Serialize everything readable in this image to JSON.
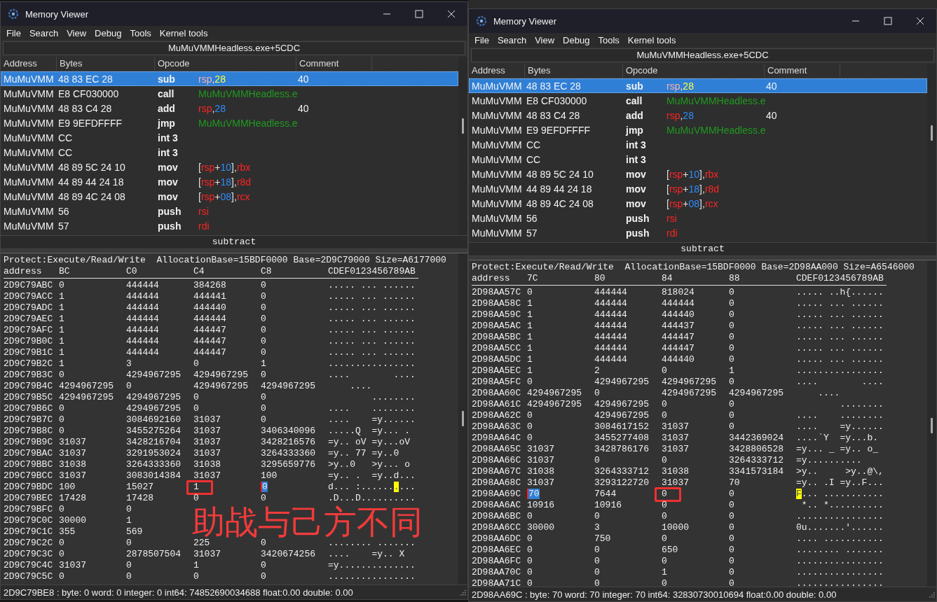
{
  "windows": [
    {
      "title": "Memory Viewer",
      "menu": [
        "File",
        "Search",
        "View",
        "Debug",
        "Tools",
        "Kernel tools"
      ],
      "address": "MuMuVMMHeadless.exe+5CDC",
      "disasm": {
        "columns": [
          "Address",
          "Bytes",
          "Opcode",
          "Comment"
        ],
        "rows": [
          {
            "address": "MuMuVMM",
            "bytes": "48 83 EC 28",
            "mnemonic": "sub",
            "operands": [
              {
                "text": "rsp",
                "kind": "reg"
              },
              {
                "text": ",",
                "kind": "punct"
              },
              {
                "text": "28",
                "kind": "num"
              }
            ],
            "comment": "40",
            "selected": true
          },
          {
            "address": "MuMuVMM",
            "bytes": "E8 CF030000",
            "mnemonic": "call",
            "operands": [
              {
                "text": "MuMuVMMHeadless.e",
                "kind": "sym"
              }
            ],
            "comment": "",
            "selected": false
          },
          {
            "address": "MuMuVMM",
            "bytes": "48 83 C4 28",
            "mnemonic": "add",
            "operands": [
              {
                "text": "rsp",
                "kind": "reg"
              },
              {
                "text": ",",
                "kind": "punct"
              },
              {
                "text": "28",
                "kind": "num"
              }
            ],
            "comment": "40",
            "selected": false
          },
          {
            "address": "MuMuVMM",
            "bytes": "E9 9EFDFFFF",
            "mnemonic": "jmp",
            "operands": [
              {
                "text": "MuMuVMMHeadless.e",
                "kind": "sym"
              }
            ],
            "comment": "",
            "selected": false
          },
          {
            "address": "MuMuVMM",
            "bytes": "CC",
            "mnemonic": "int 3",
            "operands": [],
            "comment": "",
            "selected": false
          },
          {
            "address": "MuMuVMM",
            "bytes": "CC",
            "mnemonic": "int 3",
            "operands": [],
            "comment": "",
            "selected": false
          },
          {
            "address": "MuMuVMM",
            "bytes": "48 89 5C 24 10",
            "mnemonic": "mov",
            "operands": [
              {
                "text": "[",
                "kind": "punct"
              },
              {
                "text": "rsp",
                "kind": "reg"
              },
              {
                "text": "+",
                "kind": "punct"
              },
              {
                "text": "10",
                "kind": "num"
              },
              {
                "text": "],",
                "kind": "punct"
              },
              {
                "text": "rbx",
                "kind": "reg"
              }
            ],
            "comment": "",
            "selected": false
          },
          {
            "address": "MuMuVMM",
            "bytes": "44 89 44 24 18",
            "mnemonic": "mov",
            "operands": [
              {
                "text": "[",
                "kind": "punct"
              },
              {
                "text": "rsp",
                "kind": "reg"
              },
              {
                "text": "+",
                "kind": "punct"
              },
              {
                "text": "18",
                "kind": "num"
              },
              {
                "text": "],",
                "kind": "punct"
              },
              {
                "text": "r8d",
                "kind": "reg"
              }
            ],
            "comment": "",
            "selected": false
          },
          {
            "address": "MuMuVMM",
            "bytes": "48 89 4C 24 08",
            "mnemonic": "mov",
            "operands": [
              {
                "text": "[",
                "kind": "punct"
              },
              {
                "text": "rsp",
                "kind": "reg"
              },
              {
                "text": "+",
                "kind": "punct"
              },
              {
                "text": "08",
                "kind": "num"
              },
              {
                "text": "],",
                "kind": "punct"
              },
              {
                "text": "rcx",
                "kind": "reg"
              }
            ],
            "comment": "",
            "selected": false
          },
          {
            "address": "MuMuVMM",
            "bytes": "56",
            "mnemonic": "push",
            "operands": [
              {
                "text": "rsi",
                "kind": "reg"
              }
            ],
            "comment": "",
            "selected": false
          },
          {
            "address": "MuMuVMM",
            "bytes": "57",
            "mnemonic": "push",
            "operands": [
              {
                "text": "rdi",
                "kind": "reg"
              }
            ],
            "comment": "",
            "selected": false
          }
        ]
      },
      "description": "subtract",
      "hex": {
        "info": "Protect:Execute/Read/Write  AllocationBase=15BDF0000 Base=2D9C79000 Size=A6177000",
        "address_header": "address",
        "columns": [
          "BC",
          "C0",
          "C4",
          "C8"
        ],
        "ascii_header": "CDEF0123456789AB",
        "rows": [
          {
            "address": "2D9C79ABC",
            "cells": [
              "0",
              "444444",
              "384268",
              "0"
            ],
            "ascii": "..... ... ......"
          },
          {
            "address": "2D9C79ACC",
            "cells": [
              "1",
              "444444",
              "444441",
              "0"
            ],
            "ascii": "..... ... ......"
          },
          {
            "address": "2D9C79ADC",
            "cells": [
              "1",
              "444444",
              "444440",
              "0"
            ],
            "ascii": "..... ... ......"
          },
          {
            "address": "2D9C79AEC",
            "cells": [
              "1",
              "444444",
              "444444",
              "0"
            ],
            "ascii": "..... ... ......"
          },
          {
            "address": "2D9C79AFC",
            "cells": [
              "1",
              "444444",
              "444447",
              "0"
            ],
            "ascii": "..... ... ......"
          },
          {
            "address": "2D9C79B0C",
            "cells": [
              "1",
              "444444",
              "444447",
              "0"
            ],
            "ascii": "..... ... ......"
          },
          {
            "address": "2D9C79B1C",
            "cells": [
              "1",
              "444444",
              "444447",
              "0"
            ],
            "ascii": "..... ... ......"
          },
          {
            "address": "2D9C79B2C",
            "cells": [
              "1",
              "3",
              "0",
              "1"
            ],
            "ascii": "................"
          },
          {
            "address": "2D9C79B3C",
            "cells": [
              "0",
              "4294967295",
              "4294967295",
              "0"
            ],
            "ascii": "....        ...."
          },
          {
            "address": "2D9C79B4C",
            "cells": [
              "4294967295",
              "0",
              "4294967295",
              "4294967295"
            ],
            "ascii": "    ...."
          },
          {
            "address": "2D9C79B5C",
            "cells": [
              "4294967295",
              "4294967295",
              "0",
              "0"
            ],
            "ascii": "        ........"
          },
          {
            "address": "2D9C79B6C",
            "cells": [
              "0",
              "4294967295",
              "0",
              "0"
            ],
            "ascii": "....    ........"
          },
          {
            "address": "2D9C79B7C",
            "cells": [
              "0",
              "3084692160",
              "31037",
              "0"
            ],
            "ascii": "....    =y......"
          },
          {
            "address": "2D9C79B8C",
            "cells": [
              "0",
              "3455275264",
              "31037",
              "3406340096"
            ],
            "ascii": ".....Q  =y... ."
          },
          {
            "address": "2D9C79B9C",
            "cells": [
              "31037",
              "3428216704",
              "31037",
              "3428216576"
            ],
            "ascii": "=y.. oV =y...oV"
          },
          {
            "address": "2D9C79BAC",
            "cells": [
              "31037",
              "3291953024",
              "31037",
              "3264333360"
            ],
            "ascii": "=y.. 77 =y..0"
          },
          {
            "address": "2D9C79BBC",
            "cells": [
              "31038",
              "3264333360",
              "31038",
              "3295659776"
            ],
            "ascii": ">y..0   >y... o"
          },
          {
            "address": "2D9C79BCC",
            "cells": [
              "31037",
              "3083014384",
              "31037",
              "100"
            ],
            "ascii": "=y.. .  =y..d..."
          },
          {
            "address": "2D9C79BDC",
            "cells": [
              "100",
              "15027",
              {
                "text": "1",
                "framed": true,
                "cursor": false
              },
              {
                "text": "0",
                "framed": false,
                "cursor": true
              }
            ],
            "ascii": [
              {
                "text": "d... :......",
                "cursor": false
              },
              {
                "text": ".",
                "cursor": true
              },
              {
                "text": "...",
                "cursor": false
              }
            ]
          },
          {
            "address": "2D9C79BEC",
            "cells": [
              "17428",
              "17428",
              "0",
              "0"
            ],
            "ascii": ".D...D.........."
          },
          {
            "address": "2D9C79BFC",
            "cells": [
              "0",
              "0",
              null,
              null
            ]
          },
          {
            "address": "2D9C79C0C",
            "cells": [
              "30000",
              "1",
              null,
              null
            ]
          },
          {
            "address": "2D9C79C1C",
            "cells": [
              "355",
              "569",
              null,
              null
            ]
          },
          {
            "address": "2D9C79C2C",
            "cells": [
              "0",
              "0",
              "225",
              "0"
            ],
            "ascii": "........ ......."
          },
          {
            "address": "2D9C79C3C",
            "cells": [
              "0",
              "2878507504",
              "31037",
              "3420674256"
            ],
            "ascii": "....    =y.. X"
          },
          {
            "address": "2D9C79C4C",
            "cells": [
              "31037",
              "0",
              "1",
              "0"
            ],
            "ascii": "=y.............."
          },
          {
            "address": "2D9C79C5C",
            "cells": [
              "0",
              "0",
              "0",
              "0"
            ],
            "ascii": "................"
          }
        ]
      },
      "status": "2D9C79BE8 : byte: 0 word: 0 integer: 0 int64: 74852690034688 float:0.00 double: 0.00"
    },
    {
      "title": "Memory Viewer",
      "menu": [
        "File",
        "Search",
        "View",
        "Debug",
        "Tools",
        "Kernel tools"
      ],
      "address": "MuMuVMMHeadless.exe+5CDC",
      "disasm": {
        "columns": [
          "Address",
          "Bytes",
          "Opcode",
          "Comment"
        ],
        "rows": [
          {
            "address": "MuMuVMM",
            "bytes": "48 83 EC 28",
            "mnemonic": "sub",
            "operands": [
              {
                "text": "rsp",
                "kind": "reg"
              },
              {
                "text": ",",
                "kind": "punct"
              },
              {
                "text": "28",
                "kind": "num"
              }
            ],
            "comment": "40",
            "selected": true
          },
          {
            "address": "MuMuVMM",
            "bytes": "E8 CF030000",
            "mnemonic": "call",
            "operands": [
              {
                "text": "MuMuVMMHeadless.e",
                "kind": "sym"
              }
            ],
            "comment": "",
            "selected": false
          },
          {
            "address": "MuMuVMM",
            "bytes": "48 83 C4 28",
            "mnemonic": "add",
            "operands": [
              {
                "text": "rsp",
                "kind": "reg"
              },
              {
                "text": ",",
                "kind": "punct"
              },
              {
                "text": "28",
                "kind": "num"
              }
            ],
            "comment": "40",
            "selected": false
          },
          {
            "address": "MuMuVMM",
            "bytes": "E9 9EFDFFFF",
            "mnemonic": "jmp",
            "operands": [
              {
                "text": "MuMuVMMHeadless.e",
                "kind": "sym"
              }
            ],
            "comment": "",
            "selected": false
          },
          {
            "address": "MuMuVMM",
            "bytes": "CC",
            "mnemonic": "int 3",
            "operands": [],
            "comment": "",
            "selected": false
          },
          {
            "address": "MuMuVMM",
            "bytes": "CC",
            "mnemonic": "int 3",
            "operands": [],
            "comment": "",
            "selected": false
          },
          {
            "address": "MuMuVMM",
            "bytes": "48 89 5C 24 10",
            "mnemonic": "mov",
            "operands": [
              {
                "text": "[",
                "kind": "punct"
              },
              {
                "text": "rsp",
                "kind": "reg"
              },
              {
                "text": "+",
                "kind": "punct"
              },
              {
                "text": "10",
                "kind": "num"
              },
              {
                "text": "],",
                "kind": "punct"
              },
              {
                "text": "rbx",
                "kind": "reg"
              }
            ],
            "comment": "",
            "selected": false
          },
          {
            "address": "MuMuVMM",
            "bytes": "44 89 44 24 18",
            "mnemonic": "mov",
            "operands": [
              {
                "text": "[",
                "kind": "punct"
              },
              {
                "text": "rsp",
                "kind": "reg"
              },
              {
                "text": "+",
                "kind": "punct"
              },
              {
                "text": "18",
                "kind": "num"
              },
              {
                "text": "],",
                "kind": "punct"
              },
              {
                "text": "r8d",
                "kind": "reg"
              }
            ],
            "comment": "",
            "selected": false
          },
          {
            "address": "MuMuVMM",
            "bytes": "48 89 4C 24 08",
            "mnemonic": "mov",
            "operands": [
              {
                "text": "[",
                "kind": "punct"
              },
              {
                "text": "rsp",
                "kind": "reg"
              },
              {
                "text": "+",
                "kind": "punct"
              },
              {
                "text": "08",
                "kind": "num"
              },
              {
                "text": "],",
                "kind": "punct"
              },
              {
                "text": "rcx",
                "kind": "reg"
              }
            ],
            "comment": "",
            "selected": false
          },
          {
            "address": "MuMuVMM",
            "bytes": "56",
            "mnemonic": "push",
            "operands": [
              {
                "text": "rsi",
                "kind": "reg"
              }
            ],
            "comment": "",
            "selected": false
          },
          {
            "address": "MuMuVMM",
            "bytes": "57",
            "mnemonic": "push",
            "operands": [
              {
                "text": "rdi",
                "kind": "reg"
              }
            ],
            "comment": "",
            "selected": false
          }
        ]
      },
      "description": "subtract",
      "hex": {
        "info": "Protect:Execute/Read/Write  AllocationBase=15BDF0000 Base=2D98AA000 Size=A6546000",
        "address_header": "address",
        "columns": [
          "7C",
          "80",
          "84",
          "88"
        ],
        "ascii_header": "CDEF0123456789AB",
        "rows": [
          {
            "address": "2D98AA57C",
            "cells": [
              "0",
              "444444",
              "818024",
              "0"
            ],
            "ascii": "..... ..h{......"
          },
          {
            "address": "2D98AA58C",
            "cells": [
              "1",
              "444444",
              "444444",
              "0"
            ],
            "ascii": "..... ... ......"
          },
          {
            "address": "2D98AA59C",
            "cells": [
              "1",
              "444444",
              "444440",
              "0"
            ],
            "ascii": "..... ... ......"
          },
          {
            "address": "2D98AA5AC",
            "cells": [
              "1",
              "444444",
              "444437",
              "0"
            ],
            "ascii": "..... ... ......"
          },
          {
            "address": "2D98AA5BC",
            "cells": [
              "1",
              "444444",
              "444447",
              "0"
            ],
            "ascii": "..... ... ......"
          },
          {
            "address": "2D98AA5CC",
            "cells": [
              "1",
              "444444",
              "444447",
              "0"
            ],
            "ascii": "..... ... ......"
          },
          {
            "address": "2D98AA5DC",
            "cells": [
              "1",
              "444444",
              "444440",
              "0"
            ],
            "ascii": "..... ... ......"
          },
          {
            "address": "2D98AA5EC",
            "cells": [
              "1",
              "2",
              "0",
              "1"
            ],
            "ascii": "................"
          },
          {
            "address": "2D98AA5FC",
            "cells": [
              "0",
              "4294967295",
              "4294967295",
              "0"
            ],
            "ascii": "....        ...."
          },
          {
            "address": "2D98AA60C",
            "cells": [
              "4294967295",
              "0",
              "4294967295",
              "4294967295"
            ],
            "ascii": "    ...."
          },
          {
            "address": "2D98AA61C",
            "cells": [
              "4294967295",
              "4294967295",
              "0",
              "0"
            ],
            "ascii": "        ........"
          },
          {
            "address": "2D98AA62C",
            "cells": [
              "0",
              "4294967295",
              "0",
              "0"
            ],
            "ascii": "....    ........"
          },
          {
            "address": "2D98AA63C",
            "cells": [
              "0",
              "3084617152",
              "31037",
              "0"
            ],
            "ascii": "....    =y......"
          },
          {
            "address": "2D98AA64C",
            "cells": [
              "0",
              "3455277408",
              "31037",
              "3442369024"
            ],
            "ascii": "....`Y  =y...b."
          },
          {
            "address": "2D98AA65C",
            "cells": [
              "31037",
              "3428786176",
              "31037",
              "3428806528"
            ],
            "ascii": "=y... _ =y.. o_"
          },
          {
            "address": "2D98AA66C",
            "cells": [
              "31037",
              "0",
              "0",
              "3264333712"
            ],
            "ascii": "=y.........."
          },
          {
            "address": "2D98AA67C",
            "cells": [
              "31038",
              "3264333712",
              "31038",
              "3341573184"
            ],
            "ascii": ">y..     >y..@\\,"
          },
          {
            "address": "2D98AA68C",
            "cells": [
              "31037",
              "3293122720",
              "31037",
              "70"
            ],
            "ascii": "=y.. .I =y..F..."
          },
          {
            "address": "2D98AA69C",
            "cells": [
              {
                "text": "70",
                "framed": false,
                "cursor": true
              },
              "7644",
              {
                "text": "0",
                "framed": true,
                "cursor": false
              },
              "0"
            ],
            "ascii": [
              {
                "text": "F",
                "cursor": true
              },
              {
                "text": "... ...........",
                "cursor": false
              }
            ]
          },
          {
            "address": "2D98AA6AC",
            "cells": [
              "10916",
              "10916",
              "0",
              "0"
            ],
            "ascii": " *.. *.........."
          },
          {
            "address": "2D98AA6BC",
            "cells": [
              "0",
              "0",
              "0",
              "0"
            ],
            "ascii": "................"
          },
          {
            "address": "2D98AA6CC",
            "cells": [
              "30000",
              "3",
              "10000",
              "0"
            ],
            "ascii": "0u.......'......"
          },
          {
            "address": "2D98AA6DC",
            "cells": [
              "0",
              "750",
              "0",
              "0"
            ],
            "ascii": ".... ..........."
          },
          {
            "address": "2D98AA6EC",
            "cells": [
              "0",
              "0",
              "650",
              "0"
            ],
            "ascii": "........ ......."
          },
          {
            "address": "2D98AA6FC",
            "cells": [
              "0",
              "0",
              "0",
              "0"
            ],
            "ascii": "................"
          },
          {
            "address": "2D98AA70C",
            "cells": [
              "0",
              "0",
              "1",
              "0"
            ],
            "ascii": "................"
          },
          {
            "address": "2D98AA71C",
            "cells": [
              "0",
              "0",
              "0",
              "0"
            ],
            "ascii": "................"
          }
        ]
      },
      "status": "2D98AA69C : byte: 70 word: 70 integer: 70 int64: 32830730010694 float:0.00 double: 0.00"
    }
  ],
  "annotation": {
    "text": "助战与己方不同"
  }
}
